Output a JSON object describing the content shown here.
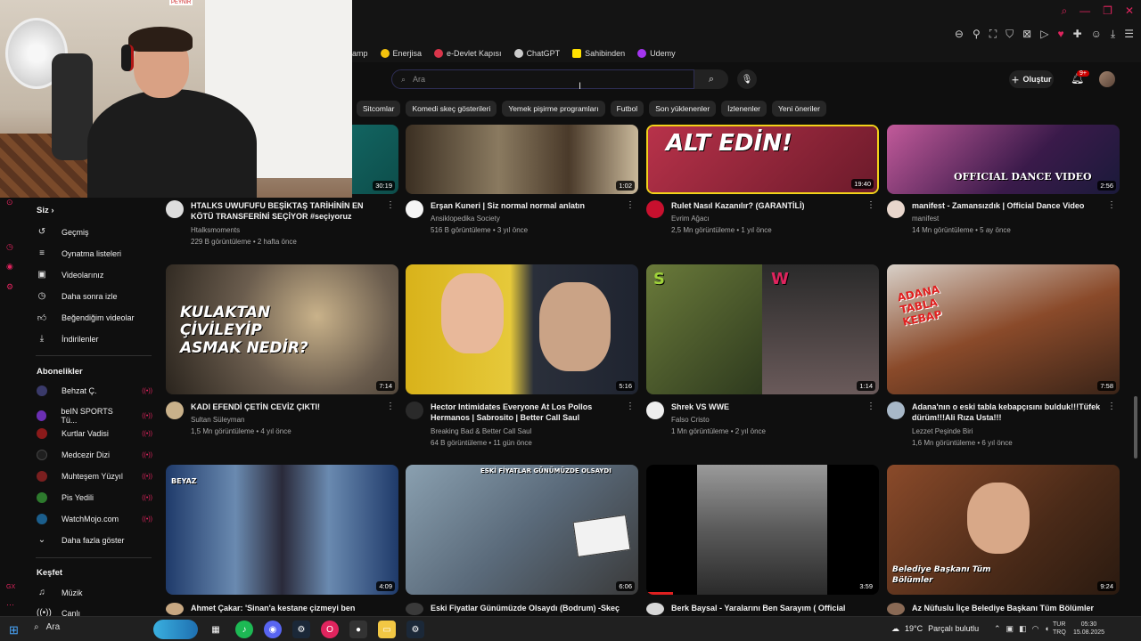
{
  "bookmarks": [
    {
      "label": "amp",
      "color": "#888888"
    },
    {
      "label": "Enerjisa",
      "color": "#f4c20d"
    },
    {
      "label": "e-Devlet Kapısı",
      "color": "#d9354a"
    },
    {
      "label": "ChatGPT",
      "color": "#cccccc"
    },
    {
      "label": "Sahibinden",
      "color": "#ffe000"
    },
    {
      "label": "Udemy",
      "color": "#a435f0"
    }
  ],
  "header": {
    "search_placeholder": "Ara",
    "create_label": "Oluştur",
    "notif_badge": "9+"
  },
  "chips": [
    "Sitcomlar",
    "Komedi skeç gösterileri",
    "Yemek pişirme programları",
    "Futbol",
    "Son yüklenenler",
    "İzlenenler",
    "Yeni öneriler"
  ],
  "sidebar": {
    "you_label": "Siz",
    "you_items": [
      {
        "label": "Geçmiş",
        "icon": "history-icon"
      },
      {
        "label": "Oynatma listeleri",
        "icon": "playlist-icon"
      },
      {
        "label": "Videolarınız",
        "icon": "video-icon"
      },
      {
        "label": "Daha sonra izle",
        "icon": "clock-icon"
      },
      {
        "label": "Beğendiğim videolar",
        "icon": "like-icon"
      },
      {
        "label": "İndirilenler",
        "icon": "download-icon"
      }
    ],
    "subs_label": "Abonelikler",
    "subs": [
      {
        "label": "Behzat Ç.",
        "color": "#3a3a6a"
      },
      {
        "label": "beIN SPORTS Tü...",
        "color": "#6b2fb3"
      },
      {
        "label": "Kurtlar Vadisi",
        "color": "#8b1a1a"
      },
      {
        "label": "Medcezir Dizi",
        "color": "#1f1f1f"
      },
      {
        "label": "Muhteşem Yüzyıl",
        "color": "#7a1f1f"
      },
      {
        "label": "Pis Yedili",
        "color": "#2d7a2d"
      },
      {
        "label": "WatchMojo.com",
        "color": "#1b5e8c"
      }
    ],
    "show_more": "Daha fazla göster",
    "explore_label": "Keşfet",
    "explore_items": [
      {
        "label": "Müzik",
        "icon": "music-icon"
      },
      {
        "label": "Canlı",
        "icon": "live-icon"
      }
    ]
  },
  "videos_row1": [
    {
      "title": "HTALKS UWUFUFU BEŞİKTAŞ TARİHİNİN EN KÖTÜ TRANSFERİNİ SEÇİYOR  #seçiyoruz",
      "channel": "Htalksmoments",
      "stats": "229 B görüntüleme • 2 hafta önce",
      "duration": "30:19",
      "thumb": "#1a8a86",
      "avatar": "#dddddd"
    },
    {
      "title": "Erşan Kuneri | Siz normal normal anlatın",
      "channel": "Ansiklopedika Society",
      "stats": "516 B görüntüleme • 3 yıl önce",
      "duration": "1:02",
      "thumb": "#6a5a45",
      "avatar": "#f5f5f5"
    },
    {
      "title": "Rulet Nasıl Kazanılır? (GARANTİLİ)",
      "channel": "Evrim Ağacı",
      "stats": "2,5 Mn görüntüleme • 1 yıl önce",
      "duration": "19:40",
      "thumb": "#b8324a",
      "avatar": "#c8102e"
    },
    {
      "title": "manifest - Zamansızdık | Official Dance Video",
      "channel": "manifest",
      "stats": "14 Mn görüntüleme • 5 ay önce",
      "duration": "2:56",
      "thumb": "#7a3a8a",
      "avatar": "#e8d6cc"
    }
  ],
  "videos_row2": [
    {
      "title": "KADI EFENDİ ÇETİN CEVİZ ÇIKTI!",
      "channel": "Sultan Süleyman",
      "stats": "1,5 Mn görüntüleme • 4 yıl önce",
      "duration": "7:14",
      "thumb": "#6b5d4e",
      "avatar": "#c9b18a",
      "overlay": "KULAKTAN ÇİVİLEYİP ASMAK NEDİR?"
    },
    {
      "title": "Hector Intimidates Everyone At Los Pollos Hermanos | Sabrosito | Better Call Saul",
      "channel": "Breaking Bad & Better Call Saul",
      "stats": "64 B görüntüleme • 11 gün önce",
      "duration": "5:16",
      "thumb": "#d8b21a",
      "avatar": "#2a2a2a"
    },
    {
      "title": "Shrek VS WWE",
      "channel": "Falso Cristo",
      "stats": "1 Mn görüntüleme • 2 yıl önce",
      "duration": "1:14",
      "thumb": "#4a5a3a",
      "avatar": "#eeeeee"
    },
    {
      "title": "Adana'nın o eski tabla kebapçısını bulduk!!!Tüfek dürüm!!!Ali Rıza Usta!!!",
      "channel": "Lezzet Peşinde Biri",
      "stats": "1,6 Mn görüntüleme • 6 yıl önce",
      "duration": "7:58",
      "thumb": "#8a4a2a",
      "avatar": "#a8b8c8",
      "overlay": "ADANA TABLA KEBAP"
    }
  ],
  "videos_row3": [
    {
      "title": "Ahmet Çakar: 'Sinan'a kestane çizmeyi ben",
      "duration": "4:09",
      "thumb": "#1f3a6a",
      "avatar": "#c8a882"
    },
    {
      "title": "Eski Fiyatlar Günümüzde Olsaydı (Bodrum) -Skeç",
      "duration": "6:06",
      "thumb": "#5a6a7a",
      "avatar": "#3a3a3a",
      "overlay": "ESKİ FİYATLAR GÜNÜMÜZDE OLSAYDI"
    },
    {
      "title": "Berk Baysal - Yaralarını Ben Sarayım ( Official",
      "duration": "3:59",
      "thumb": "#4a4a4a",
      "avatar": "#1a1a1a"
    },
    {
      "title": "Az Nüfuslu İlçe Belediye Başkanı Tüm Bölümler",
      "duration": "9:24",
      "thumb": "#6a3a22",
      "avatar": "#8a6a55",
      "overlay": "Belediye Başkanı Tüm Bölümler"
    }
  ],
  "taskbar": {
    "search_label": "Ara",
    "weather_temp": "19°C",
    "weather_text": "Parçalı bulutlu",
    "lang_line1": "TUR",
    "lang_line2": "TRQ",
    "time": "05:30",
    "date": "15.08.2025"
  },
  "webcam_logo": "PEYNIR"
}
